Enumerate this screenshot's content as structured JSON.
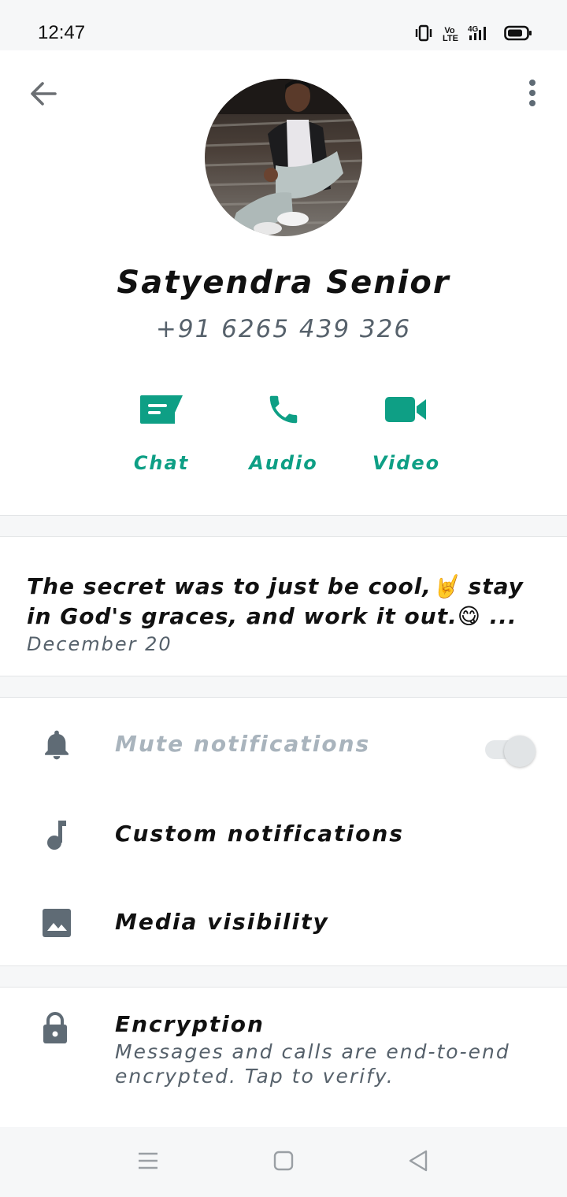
{
  "status_bar": {
    "time": "12:47",
    "icons": [
      "vibrate-icon",
      "volte-icon",
      "4g-signal-icon",
      "battery-icon"
    ],
    "volte_label": "Vo LTE",
    "network_label": "4G"
  },
  "header": {
    "back_icon": "arrow-back-icon",
    "menu_icon": "more-vert-icon"
  },
  "profile": {
    "name": "Satyendra Senior",
    "phone": "+91 6265 439 326",
    "avatar": "profile-photo"
  },
  "actions": [
    {
      "label": "Chat",
      "icon": "chat-icon"
    },
    {
      "label": "Audio",
      "icon": "phone-icon"
    },
    {
      "label": "Video",
      "icon": "videocam-icon"
    }
  ],
  "about": {
    "text": "The secret was to just be cool,🤘 stay in God's graces, and work it out.😋 ...",
    "date": "December 20"
  },
  "settings": {
    "mute": {
      "label": "Mute notifications",
      "icon": "bell-icon",
      "enabled": false,
      "toggle_on": false
    },
    "custom": {
      "label": "Custom notifications",
      "icon": "music-note-icon"
    },
    "media": {
      "label": "Media visibility",
      "icon": "image-icon"
    }
  },
  "encryption": {
    "title": "Encryption",
    "subtitle": "Messages and calls are end-to-end encrypted. Tap to verify.",
    "icon": "lock-icon"
  },
  "nav": {
    "icons": [
      "menu-icon",
      "home-icon",
      "back-triangle-icon"
    ]
  },
  "colors": {
    "accent": "#0e9f85",
    "icon_gray": "#5f6b75",
    "muted_text": "#56616b",
    "disabled_text": "#a9b4bd"
  }
}
